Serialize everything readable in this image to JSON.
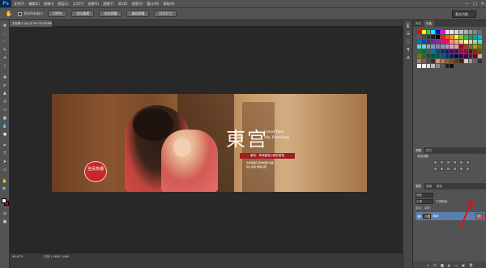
{
  "app": {
    "logo": "Ps"
  },
  "menu": [
    "文件(F)",
    "编辑(E)",
    "图像(I)",
    "图层(L)",
    "文字(Y)",
    "选择(S)",
    "滤镜(T)",
    "3D(D)",
    "视图(V)",
    "窗口(W)",
    "帮助(H)"
  ],
  "window_controls": [
    "—",
    "□",
    "✕"
  ],
  "options_bar": {
    "check_label": "滚动所有窗口",
    "buttons": [
      "100%",
      "实际像素",
      "适合屏幕",
      "填充屏幕",
      "打印尺寸"
    ],
    "workspace": "基本功能"
  },
  "document": {
    "tab_label": "无标题-1.jpg @ 66.7%(RGB/8)",
    "close": "×"
  },
  "banner": {
    "title": "東宫",
    "subtitle_line1": "Good Bye",
    "subtitle_line2": "My Princess",
    "ribbon": "東宫：李承鄞曲小枫的爱恨",
    "seal_text": "全民热播",
    "small1": "全新精美高清电视剧 热播",
    "small2": "感人爱情 唯美古装"
  },
  "status": {
    "zoom": "66.67%",
    "doc": "文档:1.46M/1.46M"
  },
  "panels": {
    "swatch_tabs": [
      "颜色",
      "色板"
    ],
    "adjust_tabs": [
      "调整",
      "样式"
    ],
    "adjust_label": "添加调整",
    "layer_tabs": [
      "图层",
      "通道",
      "路径"
    ],
    "layer_controls": {
      "kind": "类型",
      "blend": "正常",
      "opacity": "不透明度:",
      "lock": "锁定:",
      "fill": "填充:"
    },
    "layer_name": "背景",
    "layer_lock": "🔒"
  },
  "colors": {
    "swatches": [
      "#ff0000",
      "#ffff00",
      "#00ff00",
      "#00ffff",
      "#0000ff",
      "#ff00ff",
      "#ffffff",
      "#ebebeb",
      "#d6d6d6",
      "#c2c2c2",
      "#adadad",
      "#999999",
      "#858585",
      "#707070",
      "#5c5c5c",
      "#474747",
      "#333333",
      "#1f1f1f",
      "#000000",
      "#ed1c24",
      "#f26522",
      "#f7941d",
      "#fff200",
      "#8dc63f",
      "#39b54a",
      "#00a651",
      "#00a99d",
      "#00aeef",
      "#0072bc",
      "#0054a6",
      "#2e3192",
      "#662d91",
      "#92278f",
      "#ec008c",
      "#ed145b",
      "#f69679",
      "#f9ad81",
      "#fdc689",
      "#fff799",
      "#c4df9b",
      "#a3d39c",
      "#82ca9c",
      "#7accc8",
      "#6dcff6",
      "#7da7d9",
      "#8393ca",
      "#8781bd",
      "#a186be",
      "#bd8cbf",
      "#f49ac2",
      "#f6989d",
      "#9e0b0f",
      "#a0410d",
      "#a36209",
      "#aba000",
      "#598527",
      "#1a7b30",
      "#007236",
      "#00746b",
      "#0076a3",
      "#004b80",
      "#003471",
      "#1b1464",
      "#440e62",
      "#630460",
      "#9e005d",
      "#9e0039",
      "#790000",
      "#7b2e00",
      "#7d4900",
      "#827b00",
      "#406618",
      "#005e20",
      "#005826",
      "#005952",
      "#005b7f",
      "#003663",
      "#002157",
      "#0d004c",
      "#32004b",
      "#4b0049",
      "#7b0046",
      "#7a0026",
      "#c7b299",
      "#998675",
      "#736357",
      "#534741",
      "#37302a",
      "#c69c6d",
      "#a67c52",
      "#8c6239",
      "#754c24",
      "#603913",
      "#3c2415",
      "#cccccc",
      "#999999",
      "#666666",
      "#333333",
      "#ffffff",
      "#eeeeee",
      "#dddddd",
      "#bbbbbb",
      "#888888",
      "#555555",
      "#222222",
      "#111111"
    ]
  }
}
